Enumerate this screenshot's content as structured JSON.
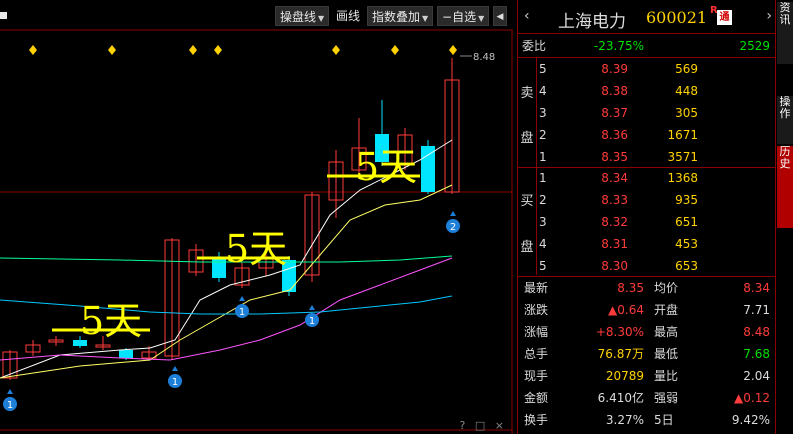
{
  "toolbar": {
    "operation_line": "操盘线",
    "draw_line": "画线",
    "index_overlay": "指数叠加",
    "self_select": "自选",
    "dropdown_arrow": "▼"
  },
  "chart": {
    "price_label": "8.48",
    "annotation_texts": [
      "5天",
      "5天",
      "5天"
    ],
    "marker_labels": [
      "1",
      "1",
      "1",
      "1",
      "2"
    ],
    "bottom_icons": [
      "?",
      "□",
      "×"
    ],
    "colors": {
      "up": "#ff3b3b",
      "down": "#00e5ff",
      "ma5": "#ffffff",
      "ma10": "#ffff66",
      "ma20": "#ff55ff",
      "ma60": "#00ff99",
      "ma120": "#00c8ff",
      "annotation": "#ffff00",
      "marker": "#1e7fd8",
      "diamond": "#ffd200",
      "grid": "#8b0000"
    }
  },
  "stock": {
    "name": "上海电力",
    "code": "600021",
    "badge_r": "R",
    "badge_tong": "通",
    "prev_icon": "‹",
    "next_icon": "›"
  },
  "ratio": {
    "label": "委比",
    "value": "-23.75%",
    "diff": "2529"
  },
  "order_book": {
    "sell_label_1": "卖",
    "sell_label_2": "盘",
    "buy_label_1": "买",
    "buy_label_2": "盘",
    "asks": [
      {
        "level": "5",
        "price": "8.39",
        "volume": "569"
      },
      {
        "level": "4",
        "price": "8.38",
        "volume": "448"
      },
      {
        "level": "3",
        "price": "8.37",
        "volume": "305"
      },
      {
        "level": "2",
        "price": "8.36",
        "volume": "1671"
      },
      {
        "level": "1",
        "price": "8.35",
        "volume": "3571"
      }
    ],
    "bids": [
      {
        "level": "1",
        "price": "8.34",
        "volume": "1368"
      },
      {
        "level": "2",
        "price": "8.33",
        "volume": "935"
      },
      {
        "level": "3",
        "price": "8.32",
        "volume": "651"
      },
      {
        "level": "4",
        "price": "8.31",
        "volume": "453"
      },
      {
        "level": "5",
        "price": "8.30",
        "volume": "653"
      }
    ]
  },
  "quote": {
    "rows": [
      {
        "l1": "最新",
        "v1": "8.35",
        "c1": "red",
        "l2": "均价",
        "v2": "8.34",
        "c2": "red"
      },
      {
        "l1": "涨跌",
        "v1": "▲0.64",
        "c1": "red",
        "l2": "开盘",
        "v2": "7.71",
        "c2": "white"
      },
      {
        "l1": "涨幅",
        "v1": "+8.30%",
        "c1": "red",
        "l2": "最高",
        "v2": "8.48",
        "c2": "red"
      },
      {
        "l1": "总手",
        "v1": "76.87万",
        "c1": "yellow",
        "l2": "最低",
        "v2": "7.68",
        "c2": "green"
      },
      {
        "l1": "现手",
        "v1": "20789",
        "c1": "yellow",
        "l2": "量比",
        "v2": "2.04",
        "c2": "white"
      },
      {
        "l1": "金额",
        "v1": "6.410亿",
        "c1": "white",
        "l2": "强弱",
        "v2": "▲0.12",
        "c2": "red"
      },
      {
        "l1": "换手",
        "v1": "3.27%",
        "c1": "white",
        "l2": "5日",
        "v2": "9.42%",
        "c2": "white"
      }
    ]
  },
  "side_strip": {
    "item_a": "资讯",
    "item_b": "操作",
    "item_c": "历史"
  }
}
